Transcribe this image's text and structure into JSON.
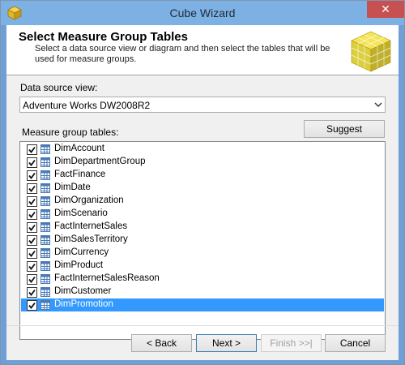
{
  "window": {
    "title": "Cube Wizard",
    "close_label": "✕"
  },
  "header": {
    "title": "Select Measure Group Tables",
    "description": "Select a data source view or diagram and then select the tables that will be used for measure groups."
  },
  "data_source": {
    "label": "Data source view:",
    "value": "Adventure Works DW2008R2"
  },
  "measure_groups": {
    "label": "Measure group tables:",
    "suggest_label": "Suggest",
    "items": [
      {
        "name": "DimAccount",
        "checked": true
      },
      {
        "name": "DimDepartmentGroup",
        "checked": true
      },
      {
        "name": "FactFinance",
        "checked": true
      },
      {
        "name": "DimDate",
        "checked": true
      },
      {
        "name": "DimOrganization",
        "checked": true
      },
      {
        "name": "DimScenario",
        "checked": true
      },
      {
        "name": "FactInternetSales",
        "checked": true
      },
      {
        "name": "DimSalesTerritory",
        "checked": true
      },
      {
        "name": "DimCurrency",
        "checked": true
      },
      {
        "name": "DimProduct",
        "checked": true
      },
      {
        "name": "FactInternetSalesReason",
        "checked": true
      },
      {
        "name": "DimCustomer",
        "checked": true
      },
      {
        "name": "DimPromotion",
        "checked": true,
        "selected": true
      }
    ]
  },
  "buttons": {
    "back": "< Back",
    "next": "Next >",
    "finish": "Finish >>|",
    "cancel": "Cancel"
  },
  "colors": {
    "selection": "#3399ff",
    "titlebar": "#7db0e3",
    "close": "#c75050"
  }
}
